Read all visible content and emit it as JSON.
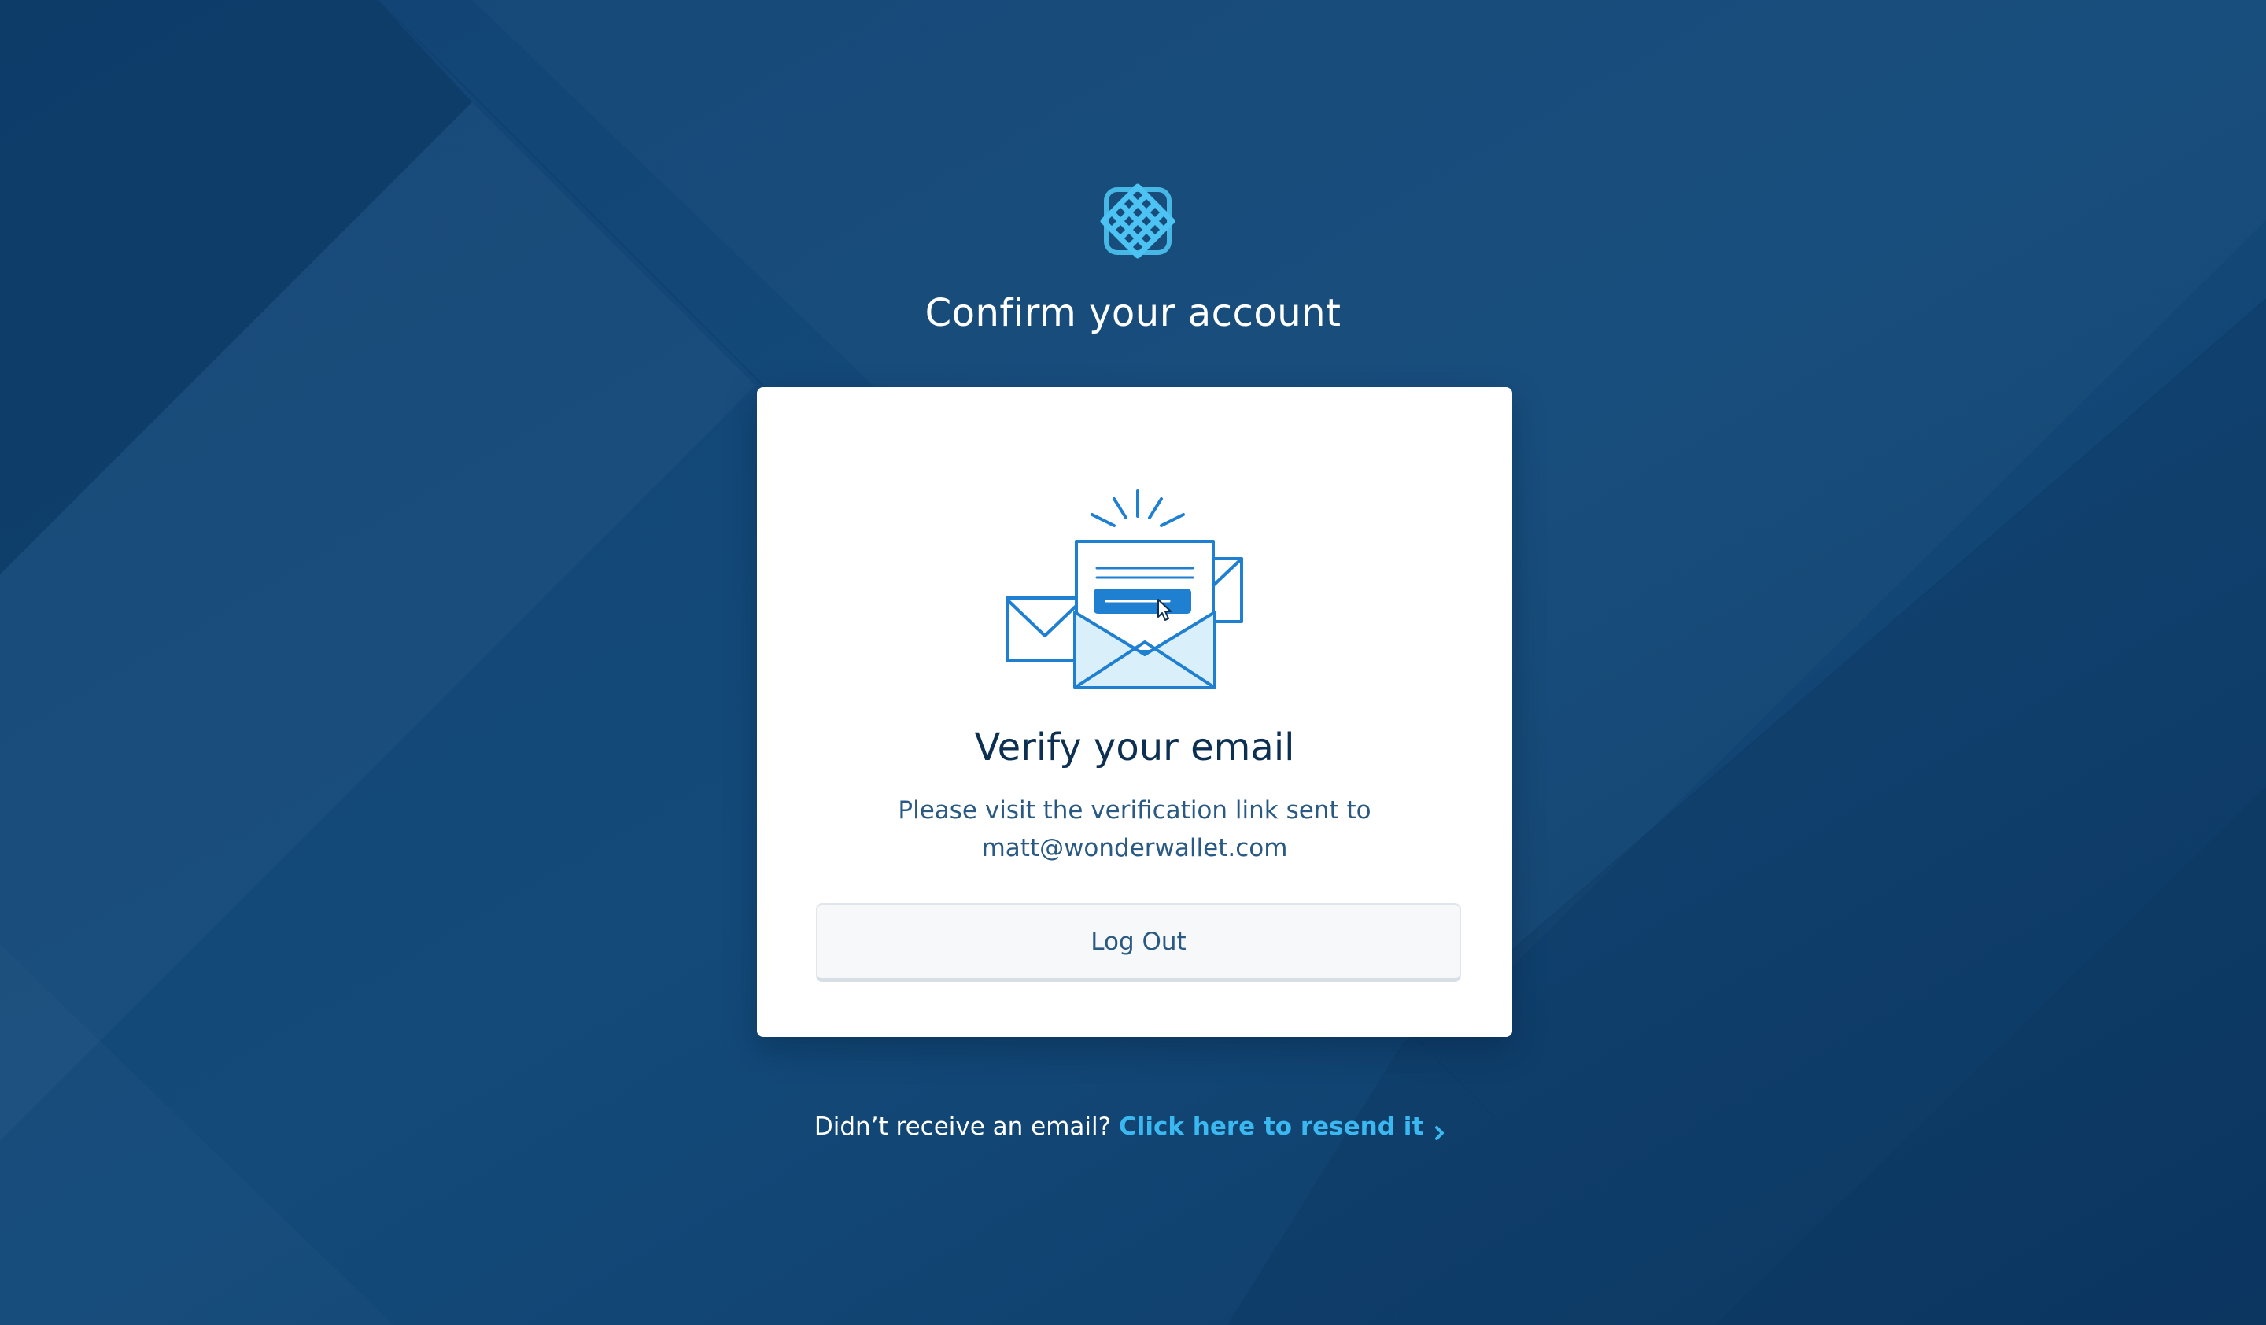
{
  "page": {
    "title": "Confirm your account"
  },
  "logo": {
    "icon": "lattice-logo-icon",
    "color": "#4cc3f2"
  },
  "card": {
    "illustration": "email-envelopes-icon",
    "title": "Verify your email",
    "message_line1": "Please visit the verification link sent to",
    "message_line2": "matt@wonderwallet.com",
    "logout_label": "Log Out"
  },
  "footer": {
    "prompt": "Didn’t receive an email?",
    "resend_link": "Click here to resend it",
    "link_icon": "chevron-right-icon"
  },
  "colors": {
    "background": "#134572",
    "accent": "#3cb8f0",
    "illustration_blue": "#1f7fd1"
  }
}
